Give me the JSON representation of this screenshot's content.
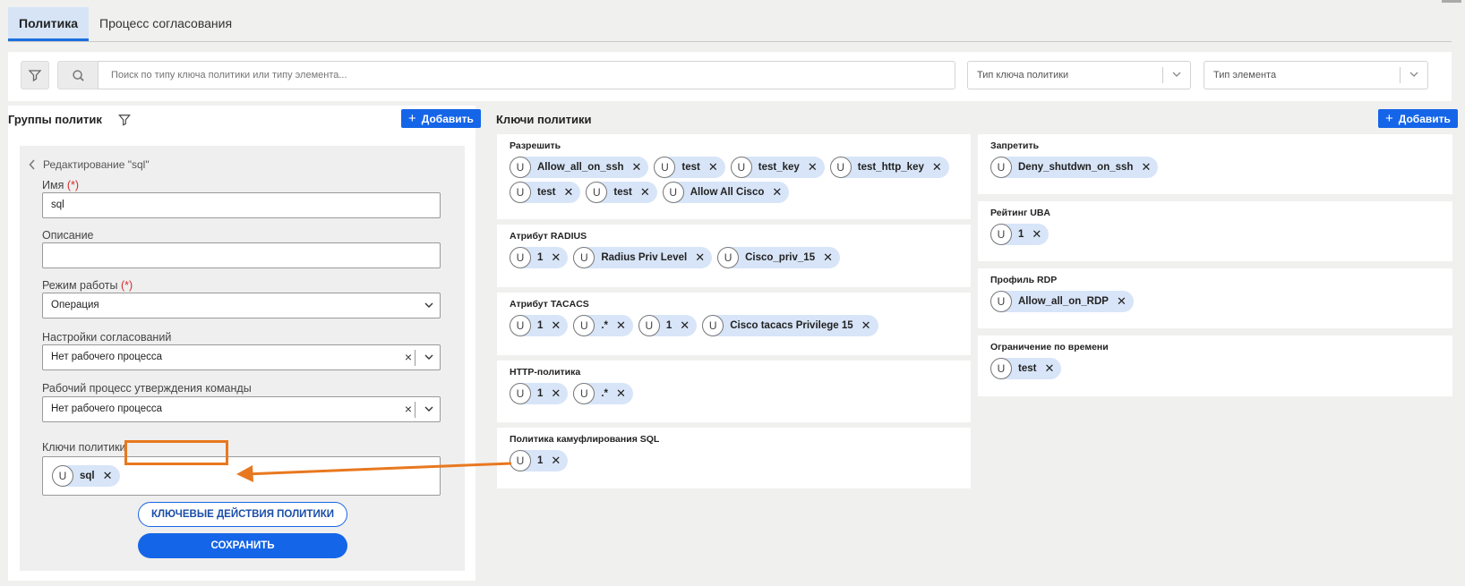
{
  "tabs": [
    {
      "label": "Политика",
      "active": true
    },
    {
      "label": "Процесс согласования",
      "active": false
    }
  ],
  "search": {
    "placeholder": "Поиск по типу ключа политики или типу элемента...",
    "key_type_select": "Тип ключа политики",
    "element_type_select": "Тип элемента"
  },
  "groups_panel": {
    "title": "Группы политик",
    "add_label": "Добавить",
    "edit_title": "Редактирование \"sql\"",
    "name_label": "Имя",
    "name_value": "sql",
    "desc_label": "Описание",
    "desc_value": "",
    "mode_label": "Режим работы",
    "mode_value": "Операция",
    "approval_label": "Настройки согласований",
    "approval_value": "Нет рабочего процесса",
    "cmd_label": "Рабочий процесс утверждения команды",
    "cmd_value": "Нет рабочего процесса",
    "keys_label": "Ключи политики",
    "required_mark": "(*)",
    "keys": [
      "sql"
    ],
    "actions_button": "КЛЮЧЕВЫЕ ДЕЙСТВИЯ ПОЛИТИКИ",
    "save_button": "СОХРАНИТЬ"
  },
  "keys_panel": {
    "title": "Ключи политики",
    "add_label": "Добавить",
    "chip_letter": "U",
    "left_cards": [
      {
        "title": "Разрешить",
        "chips": [
          "Allow_all_on_ssh",
          "test",
          "test_key",
          "test_http_key",
          "test",
          "test",
          "Allow All Cisco"
        ]
      },
      {
        "title": "Атрибут RADIUS",
        "chips": [
          "1",
          "Radius Priv Level",
          "Cisco_priv_15"
        ]
      },
      {
        "title": "Атрибут TACACS",
        "chips": [
          "1",
          ".*",
          "1",
          "Cisco tacacs Privilege 15"
        ]
      },
      {
        "title": "HTTP-политика",
        "chips": [
          "1",
          ".*"
        ]
      },
      {
        "title": "Политика камуфлирования SQL",
        "chips": [
          "1"
        ]
      }
    ],
    "right_cards": [
      {
        "title": "Запретить",
        "chips": [
          "Deny_shutdwn_on_ssh"
        ]
      },
      {
        "title": "Рейтинг UBA",
        "chips": [
          "1"
        ]
      },
      {
        "title": "Профиль RDP",
        "chips": [
          "Allow_all_on_RDP"
        ]
      },
      {
        "title": "Ограничение по времени",
        "chips": [
          "test"
        ]
      }
    ]
  },
  "colors": {
    "accent": "#1565e8",
    "chip_bg": "#d8e5f8",
    "annotation": "#e8781f"
  }
}
